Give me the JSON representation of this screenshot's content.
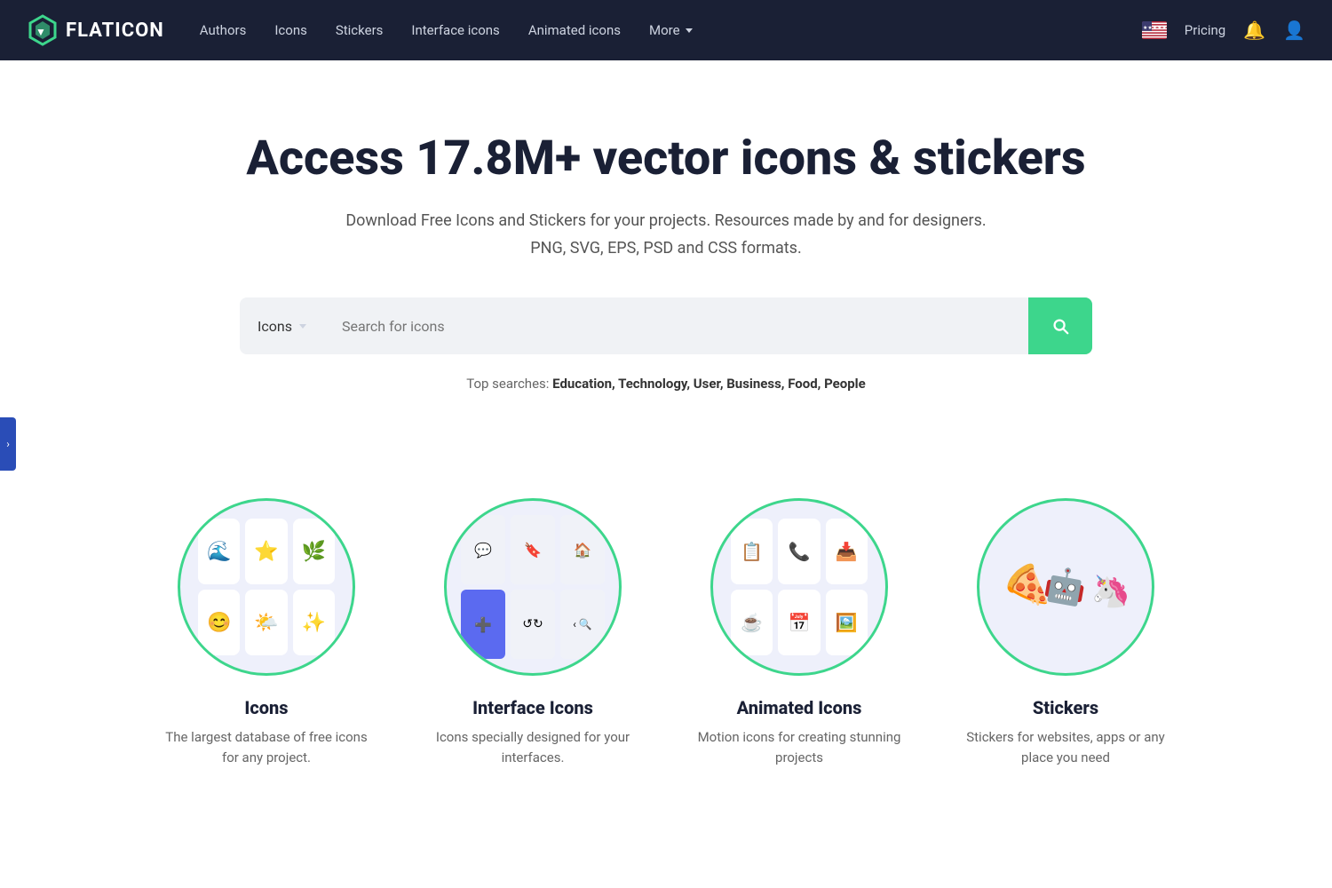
{
  "nav": {
    "logo_text": "FLATICON",
    "links": [
      {
        "label": "Authors",
        "name": "nav-authors"
      },
      {
        "label": "Icons",
        "name": "nav-icons"
      },
      {
        "label": "Stickers",
        "name": "nav-stickers"
      },
      {
        "label": "Interface icons",
        "name": "nav-interface-icons"
      },
      {
        "label": "Animated icons",
        "name": "nav-animated-icons"
      },
      {
        "label": "More",
        "name": "nav-more"
      }
    ],
    "pricing": "Pricing"
  },
  "hero": {
    "title": "Access 17.8M+ vector icons & stickers",
    "subtitle_line1": "Download Free Icons and Stickers for your projects. Resources made by and for designers.",
    "subtitle_line2": "PNG, SVG, EPS, PSD and CSS formats.",
    "search": {
      "dropdown_label": "Icons",
      "placeholder": "Search for icons",
      "button_label": "Search"
    },
    "top_searches_label": "Top searches:",
    "top_searches": "Education, Technology, User, Business, Food, People"
  },
  "categories": [
    {
      "name": "icons-category",
      "title": "Icons",
      "desc": "The largest database of free icons for any project."
    },
    {
      "name": "interface-icons-category",
      "title": "Interface Icons",
      "desc": "Icons specially designed for your interfaces."
    },
    {
      "name": "animated-icons-category",
      "title": "Animated Icons",
      "desc": "Motion icons for creating stunning projects"
    },
    {
      "name": "stickers-category",
      "title": "Stickers",
      "desc": "Stickers for websites, apps or any place you need"
    }
  ],
  "side_arrow": "›"
}
